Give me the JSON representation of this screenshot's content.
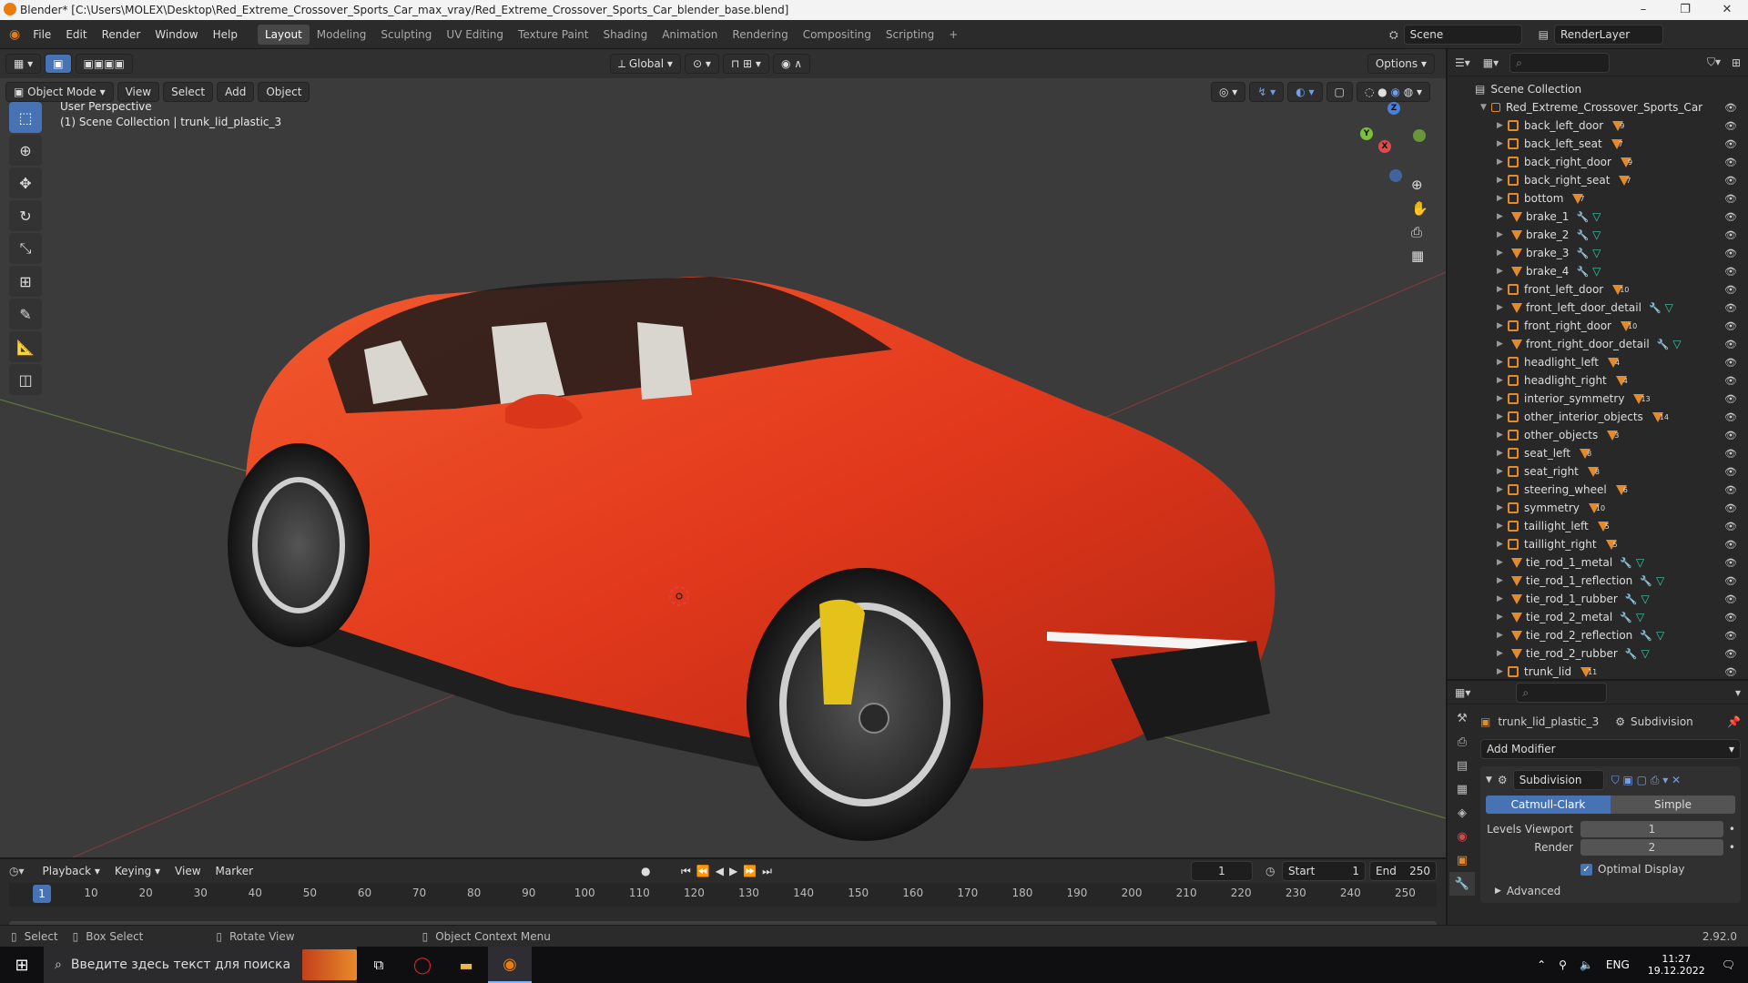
{
  "window": {
    "title": "Blender* [C:\\Users\\MOLEX\\Desktop\\Red_Extreme_Crossover_Sports_Car_max_vray/Red_Extreme_Crossover_Sports_Car_blender_base.blend]",
    "controls": [
      "–",
      "❐",
      "✕"
    ]
  },
  "menu": [
    "File",
    "Edit",
    "Render",
    "Window",
    "Help"
  ],
  "workspaces": [
    "Layout",
    "Modeling",
    "Sculpting",
    "UV Editing",
    "Texture Paint",
    "Shading",
    "Animation",
    "Rendering",
    "Compositing",
    "Scripting",
    "+"
  ],
  "scene": {
    "label": "Scene",
    "render_layer": "RenderLayer"
  },
  "viewport": {
    "transform": "Global",
    "options": "Options",
    "mode": "Object Mode",
    "menus": [
      "View",
      "Select",
      "Add",
      "Object"
    ],
    "overlay_title": "User Perspective",
    "overlay_sub": "(1) Scene Collection | trunk_lid_plastic_3",
    "gizmo": {
      "x": "X",
      "y": "Y",
      "z": "Z"
    }
  },
  "tools": [
    "select-box",
    "cursor",
    "move",
    "rotate",
    "scale",
    "transform",
    "annotate",
    "measure",
    "add-cube"
  ],
  "outliner": {
    "root": "Scene Collection",
    "collection": "Red_Extreme_Crossover_Sports_Car",
    "items": [
      {
        "name": "back_left_door",
        "type": "empty",
        "count": "9"
      },
      {
        "name": "back_left_seat",
        "type": "empty",
        "count": "7"
      },
      {
        "name": "back_right_door",
        "type": "empty",
        "count": "9"
      },
      {
        "name": "back_right_seat",
        "type": "empty",
        "count": "7"
      },
      {
        "name": "bottom",
        "type": "empty",
        "count": "7"
      },
      {
        "name": "brake_1",
        "type": "mesh",
        "count": ""
      },
      {
        "name": "brake_2",
        "type": "mesh",
        "count": ""
      },
      {
        "name": "brake_3",
        "type": "mesh",
        "count": ""
      },
      {
        "name": "brake_4",
        "type": "mesh",
        "count": ""
      },
      {
        "name": "front_left_door",
        "type": "empty",
        "count": "10"
      },
      {
        "name": "front_left_door_detail",
        "type": "mesh",
        "count": ""
      },
      {
        "name": "front_right_door",
        "type": "empty",
        "count": "10"
      },
      {
        "name": "front_right_door_detail",
        "type": "mesh",
        "count": ""
      },
      {
        "name": "headlight_left",
        "type": "empty",
        "count": "4"
      },
      {
        "name": "headlight_right",
        "type": "empty",
        "count": "4"
      },
      {
        "name": "interior_symmetry",
        "type": "empty",
        "count": "13"
      },
      {
        "name": "other_interior_objects",
        "type": "empty",
        "count": "14"
      },
      {
        "name": "other_objects",
        "type": "empty",
        "count": "3"
      },
      {
        "name": "seat_left",
        "type": "empty",
        "count": "8"
      },
      {
        "name": "seat_right",
        "type": "empty",
        "count": "8"
      },
      {
        "name": "steering_wheel",
        "type": "empty",
        "count": "6"
      },
      {
        "name": "symmetry",
        "type": "empty",
        "count": "10"
      },
      {
        "name": "taillight_left",
        "type": "empty",
        "count": "5"
      },
      {
        "name": "taillight_right",
        "type": "empty",
        "count": "5"
      },
      {
        "name": "tie_rod_1_metal",
        "type": "mesh",
        "count": ""
      },
      {
        "name": "tie_rod_1_reflection",
        "type": "mesh",
        "count": ""
      },
      {
        "name": "tie_rod_1_rubber",
        "type": "mesh",
        "count": ""
      },
      {
        "name": "tie_rod_2_metal",
        "type": "mesh",
        "count": ""
      },
      {
        "name": "tie_rod_2_reflection",
        "type": "mesh",
        "count": ""
      },
      {
        "name": "tie_rod_2_rubber",
        "type": "mesh",
        "count": ""
      },
      {
        "name": "trunk_lid",
        "type": "empty",
        "count": "11"
      }
    ]
  },
  "properties": {
    "object": "trunk_lid_plastic_3",
    "modifier_tab": "Subdivision",
    "add_modifier": "Add Modifier",
    "modifier_name": "Subdivision",
    "catmull": "Catmull-Clark",
    "simple": "Simple",
    "levels_label": "Levels Viewport",
    "levels_value": "1",
    "render_label": "Render",
    "render_value": "2",
    "optimal": "Optimal Display",
    "advanced": "Advanced"
  },
  "timeline": {
    "menus": [
      "Playback",
      "Keying",
      "View",
      "Marker"
    ],
    "current": "1",
    "start_label": "Start",
    "start": "1",
    "end_label": "End",
    "end": "250",
    "ticks": [
      "1",
      "10",
      "20",
      "30",
      "40",
      "50",
      "60",
      "70",
      "80",
      "90",
      "100",
      "110",
      "120",
      "130",
      "140",
      "150",
      "160",
      "170",
      "180",
      "190",
      "200",
      "210",
      "220",
      "230",
      "240",
      "250"
    ]
  },
  "statusbar": {
    "select": "Select",
    "box_select": "Box Select",
    "rotate": "Rotate View",
    "context": "Object Context Menu",
    "version": "2.92.0"
  },
  "taskbar": {
    "search": "Введите здесь текст для поиска",
    "lang": "ENG",
    "time": "11:27",
    "date": "19.12.2022"
  },
  "colors": {
    "accent": "#4772b3",
    "car": "#e2391c",
    "empty": "#e38a2a",
    "mesh": "#3dc7a8"
  }
}
